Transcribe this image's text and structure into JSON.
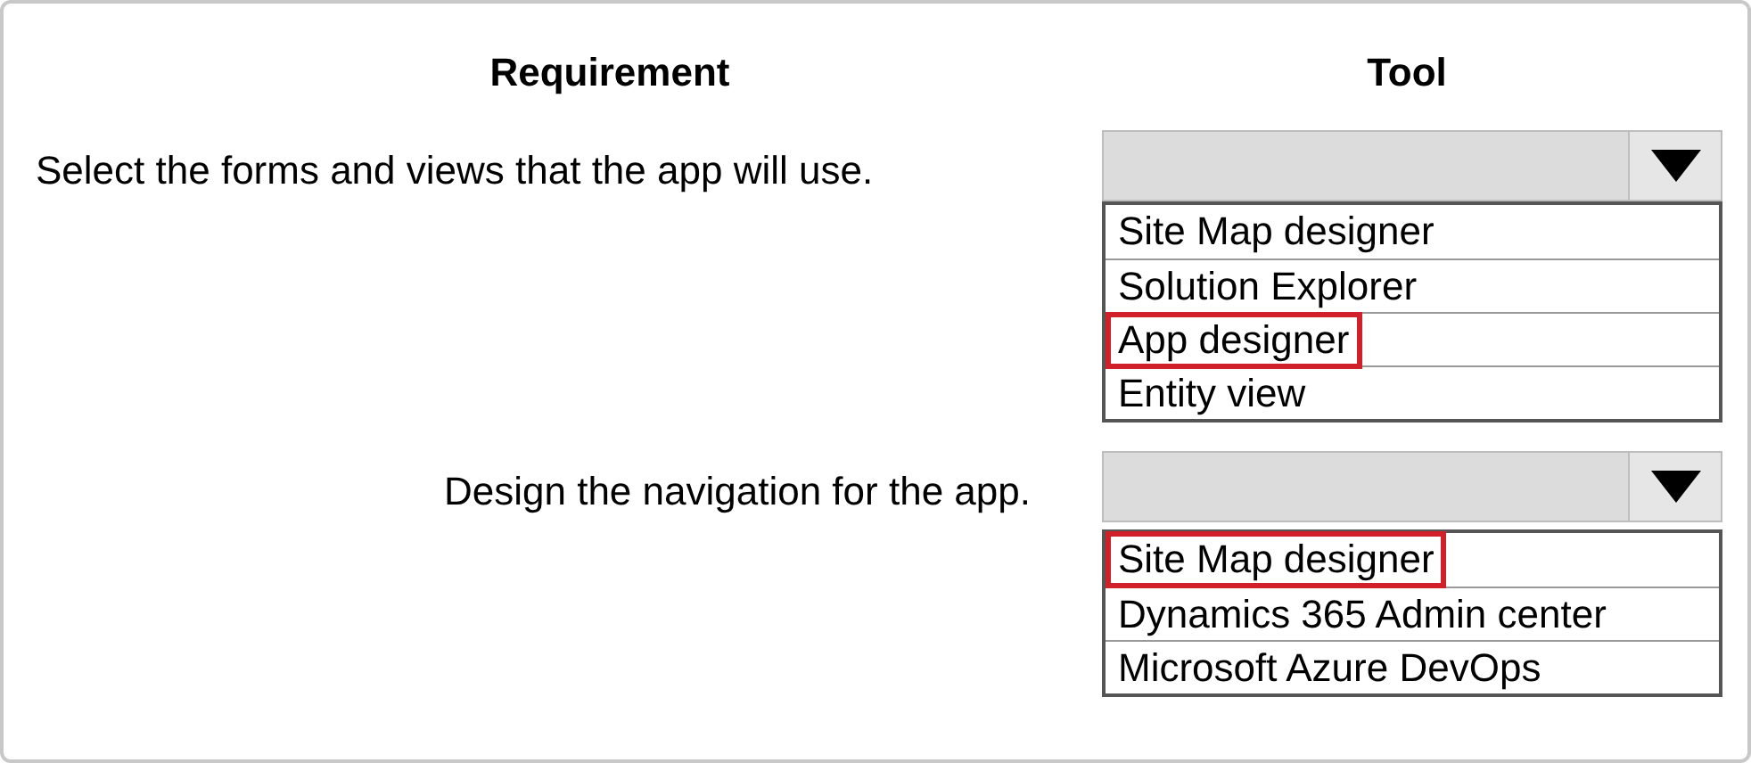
{
  "headers": {
    "requirement": "Requirement",
    "tool": "Tool"
  },
  "rows": [
    {
      "requirement": "Select the forms and views that the app will use.",
      "kind": "left",
      "options": [
        {
          "label": "Site Map designer",
          "selected": false
        },
        {
          "label": "Solution Explorer",
          "selected": false
        },
        {
          "label": "App designer",
          "selected": true
        },
        {
          "label": "Entity view",
          "selected": false
        }
      ]
    },
    {
      "requirement": "Design the navigation for the app.",
      "kind": "right",
      "options": [
        {
          "label": "Site Map designer",
          "selected": true
        },
        {
          "label": "Dynamics 365 Admin center",
          "selected": false
        },
        {
          "label": "Microsoft Azure DevOps",
          "selected": false
        }
      ]
    }
  ]
}
